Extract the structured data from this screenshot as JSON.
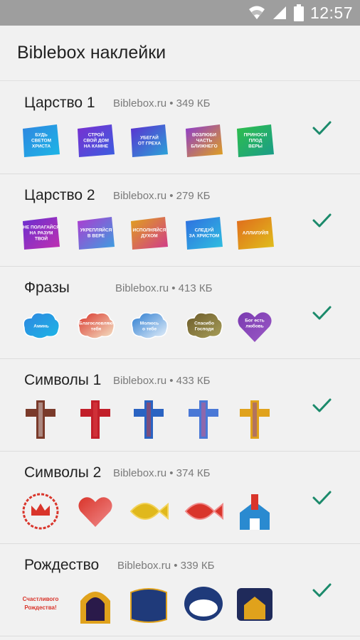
{
  "status": {
    "time": "12:57",
    "icons": [
      "wifi-icon",
      "signal-icon",
      "battery-icon"
    ]
  },
  "app": {
    "title": "Biblebox наклейки"
  },
  "colors": {
    "check": "#1b8a6b",
    "statusbar": "#9e9e9e",
    "background": "#f1f1f1"
  },
  "packs": [
    {
      "name": "Царство 1",
      "meta": "Biblebox.ru • 349 КБ",
      "stickers": [
        {
          "kind": "badge",
          "fill": "#2f86e0",
          "fill2": "#1cb6e6",
          "text": [
            "БУДЬ",
            "СВЕТОМ",
            "ХРИСТА"
          ]
        },
        {
          "kind": "badge",
          "fill": "#7a2fd0",
          "fill2": "#3a5ee0",
          "text": [
            "СТРОЙ",
            "СВОЙ ДОМ",
            "НА КАМНЕ"
          ]
        },
        {
          "kind": "badge",
          "fill": "#5b2fd0",
          "fill2": "#2aa6d8",
          "text": [
            "УБЕГАЙ",
            "ОТ ГРЕХА"
          ]
        },
        {
          "kind": "badge",
          "fill": "#8c3ad0",
          "fill2": "#e0a21c",
          "text": [
            "ВОЗЛЮБИ",
            "ЧАСТЬ",
            "БЛИЖНЕГО"
          ]
        },
        {
          "kind": "badge",
          "fill": "#2fbf4a",
          "fill2": "#1a9c8a",
          "text": [
            "ПРИНОСИ",
            "ПЛОД",
            "ВЕРЫ"
          ]
        }
      ]
    },
    {
      "name": "Царство 2",
      "meta": "Biblebox.ru • 279 КБ",
      "stickers": [
        {
          "kind": "badge",
          "fill": "#6a2fd0",
          "fill2": "#c030b0",
          "text": [
            "НЕ ПОЛАГАЙСЯ",
            "НА РАЗУМ",
            "ТВОЙ"
          ]
        },
        {
          "kind": "badge",
          "fill": "#b03ad0",
          "fill2": "#3aa0e0",
          "text": [
            "УКРЕПЛЯЙСЯ",
            "В ВЕРЕ"
          ]
        },
        {
          "kind": "badge",
          "fill": "#e0a21c",
          "fill2": "#d03a8c",
          "text": [
            "ИСПОЛНЯЙСЯ",
            "ДУХОМ"
          ]
        },
        {
          "kind": "badge",
          "fill": "#2f6ee0",
          "fill2": "#2fc0e0",
          "text": [
            "СЛЕДУЙ",
            "ЗА ХРИСТОМ"
          ]
        },
        {
          "kind": "badge",
          "fill": "#e06a1c",
          "fill2": "#e0c01c",
          "text": [
            "АЛЛИЛУЙЯ"
          ]
        }
      ]
    },
    {
      "name": "Фразы",
      "meta": "Biblebox.ru • 413 КБ",
      "stickers": [
        {
          "kind": "cloud",
          "fill": "#2f86e0",
          "fill2": "#1cb6e6",
          "text": [
            "Аминь"
          ]
        },
        {
          "kind": "cloud",
          "fill": "#d9352b",
          "fill2": "#f5e6c8",
          "text": [
            "Благословляю",
            "тебя"
          ]
        },
        {
          "kind": "cloud",
          "fill": "#2a7bd0",
          "fill2": "#e8f2fb",
          "text": [
            "Молюсь",
            "о тебе"
          ]
        },
        {
          "kind": "cloud",
          "fill": "#6b5a2a",
          "fill2": "#a9a05a",
          "text": [
            "Спасибо",
            "Господи"
          ]
        },
        {
          "kind": "heart",
          "fill": "#7a3ab0",
          "fill2": "#9b59c6",
          "text": [
            "Бог есть",
            "любовь"
          ]
        }
      ]
    },
    {
      "name": "Символы 1",
      "meta": "Biblebox.ru • 433 КБ",
      "stickers": [
        {
          "kind": "cross",
          "fill": "#7a3a2a",
          "fill2": "#e9e9e9"
        },
        {
          "kind": "cross",
          "fill": "#c21f2a",
          "fill2": "#e0444a"
        },
        {
          "kind": "cross",
          "fill": "#2a63c2",
          "fill2": "#d9352b"
        },
        {
          "kind": "cross",
          "fill": "#4a78d6",
          "fill2": "#e0557a"
        },
        {
          "kind": "cross",
          "fill": "#e0a21c",
          "fill2": "#7a3ab0"
        }
      ]
    },
    {
      "name": "Символы 2",
      "meta": "Biblebox.ru • 374 КБ",
      "stickers": [
        {
          "kind": "crown",
          "fill": "#d9352b",
          "fill2": "#ffffff"
        },
        {
          "kind": "heart",
          "fill": "#d9352b",
          "fill2": "#f08a8a",
          "text": []
        },
        {
          "kind": "fish",
          "fill": "#e0b81c",
          "fill2": "#f3d35a"
        },
        {
          "kind": "fish",
          "fill": "#d9352b",
          "fill2": "#f08a8a"
        },
        {
          "kind": "church",
          "fill": "#2a8ad0",
          "fill2": "#d9352b"
        }
      ]
    },
    {
      "name": "Рождество",
      "meta": "Biblebox.ru • 339 КБ",
      "stickers": [
        {
          "kind": "script",
          "fill": "#d9352b",
          "fill2": "#ffffff",
          "text": [
            "Счастливого",
            "Рождества!"
          ]
        },
        {
          "kind": "arch",
          "fill": "#e0a21c",
          "fill2": "#2a1a4a"
        },
        {
          "kind": "label",
          "fill": "#1f3a7a",
          "fill2": "#e0a21c"
        },
        {
          "kind": "oval",
          "fill": "#1f3a7a",
          "fill2": "#ffffff"
        },
        {
          "kind": "square",
          "fill": "#1f2a5a",
          "fill2": "#e0a21c"
        }
      ]
    }
  ]
}
